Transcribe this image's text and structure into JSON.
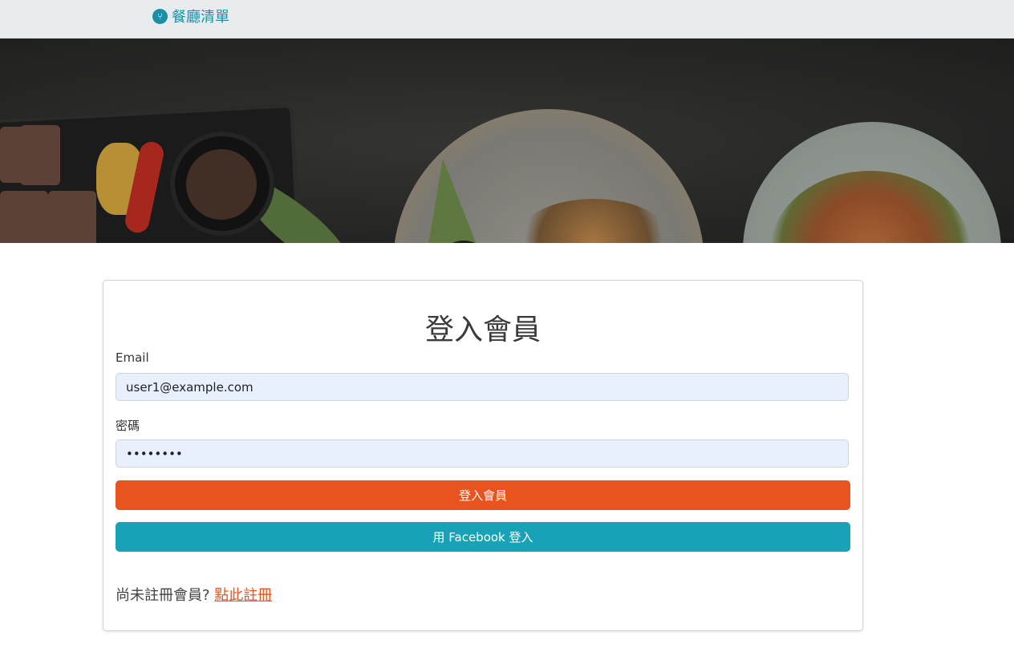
{
  "navbar": {
    "brand_label": "餐廳清單"
  },
  "login": {
    "title": "登入會員",
    "email_label": "Email",
    "email_value": "user1@example.com",
    "password_label": "密碼",
    "password_value": "••••••••",
    "login_button": "登入會員",
    "facebook_button": "用 Facebook 登入",
    "signup_prompt": "尚未註冊會員?",
    "signup_link": "點此註冊"
  },
  "colors": {
    "brand": "#1a8fa6",
    "primary_button": "#e9531f",
    "facebook_button": "#17a2b8",
    "input_bg": "#e8f0fe"
  },
  "icons": {
    "brand": "utensils-icon"
  }
}
